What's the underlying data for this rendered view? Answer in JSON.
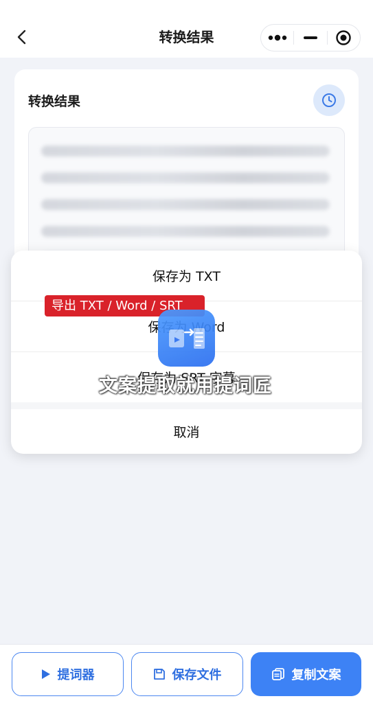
{
  "navbar": {
    "title": "转换结果",
    "back_icon": "chevron-left-icon",
    "capsule_icons": [
      "more-dots-icon",
      "minimize-icon",
      "record-icon"
    ]
  },
  "result_card": {
    "title": "转换结果",
    "history_icon": "clock-icon"
  },
  "action_sheet": {
    "options": [
      {
        "label": "保存为 TXT"
      },
      {
        "label": "保存为 Word"
      },
      {
        "label": "保存为 SRT 字幕"
      }
    ],
    "cancel_label": "取消"
  },
  "overlay": {
    "banner_text": "导出 TXT / Word / SRT",
    "watermark_text": "文案提取就用提词匠",
    "banner_color": "#d9222a"
  },
  "bottom_bar": {
    "prompter_label": "提词器",
    "save_file_label": "保存文件",
    "copy_label": "复制文案",
    "accent": "#3d82f5"
  }
}
